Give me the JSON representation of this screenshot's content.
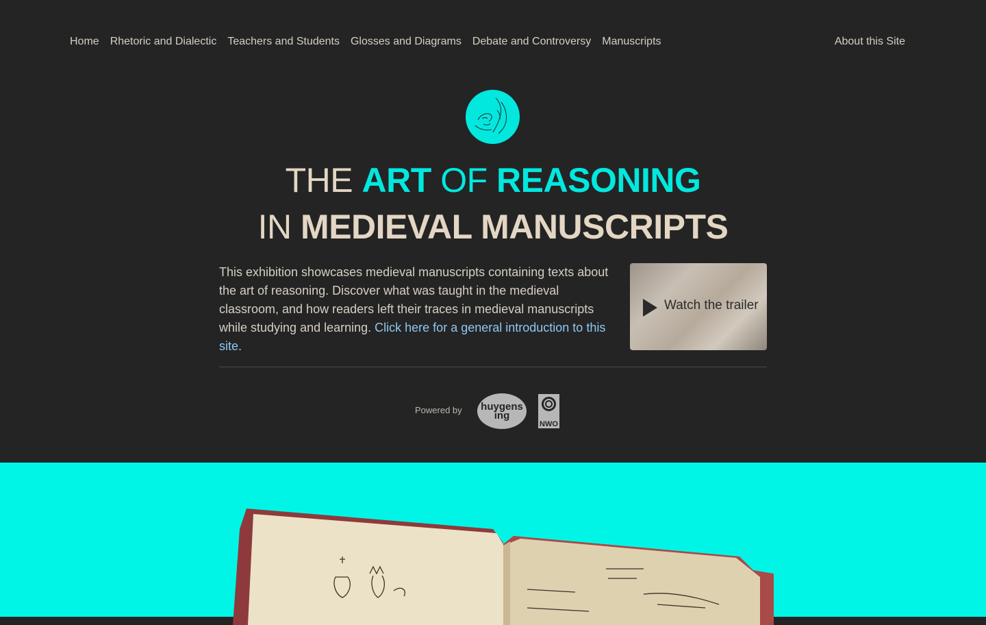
{
  "nav": {
    "items": [
      "Home",
      "Rhetoric and Dialectic",
      "Teachers and Students",
      "Glosses and Diagrams",
      "Debate and Controversy",
      "Manuscripts"
    ],
    "about": "About this Site"
  },
  "title": {
    "line1": {
      "w1": "THE",
      "w2": "ART",
      "w3": "OF",
      "w4": "REASONING"
    },
    "line2": {
      "w1": "IN",
      "w2": "MEDIEVAL MANUSCRIPTS"
    }
  },
  "intro": {
    "text": "This exhibition showcases medieval manuscripts containing texts about the art of reasoning. Discover what was taught in the medieval classroom, and how readers left their traces in medieval manuscripts while studying and learning. ",
    "link": "Click here for a general introduction to this site",
    "end": "."
  },
  "trailer": {
    "label": "Watch the trailer",
    "icon": "play-icon"
  },
  "footer": {
    "powered": "Powered by",
    "huygens_logo": "huygens ing",
    "nwo_logo": "NWO"
  },
  "colors": {
    "background": "#242424",
    "accent": "#02e8df",
    "cream": "#e3d6c4",
    "link": "#8fc7f2",
    "band": "#00f5e6"
  }
}
